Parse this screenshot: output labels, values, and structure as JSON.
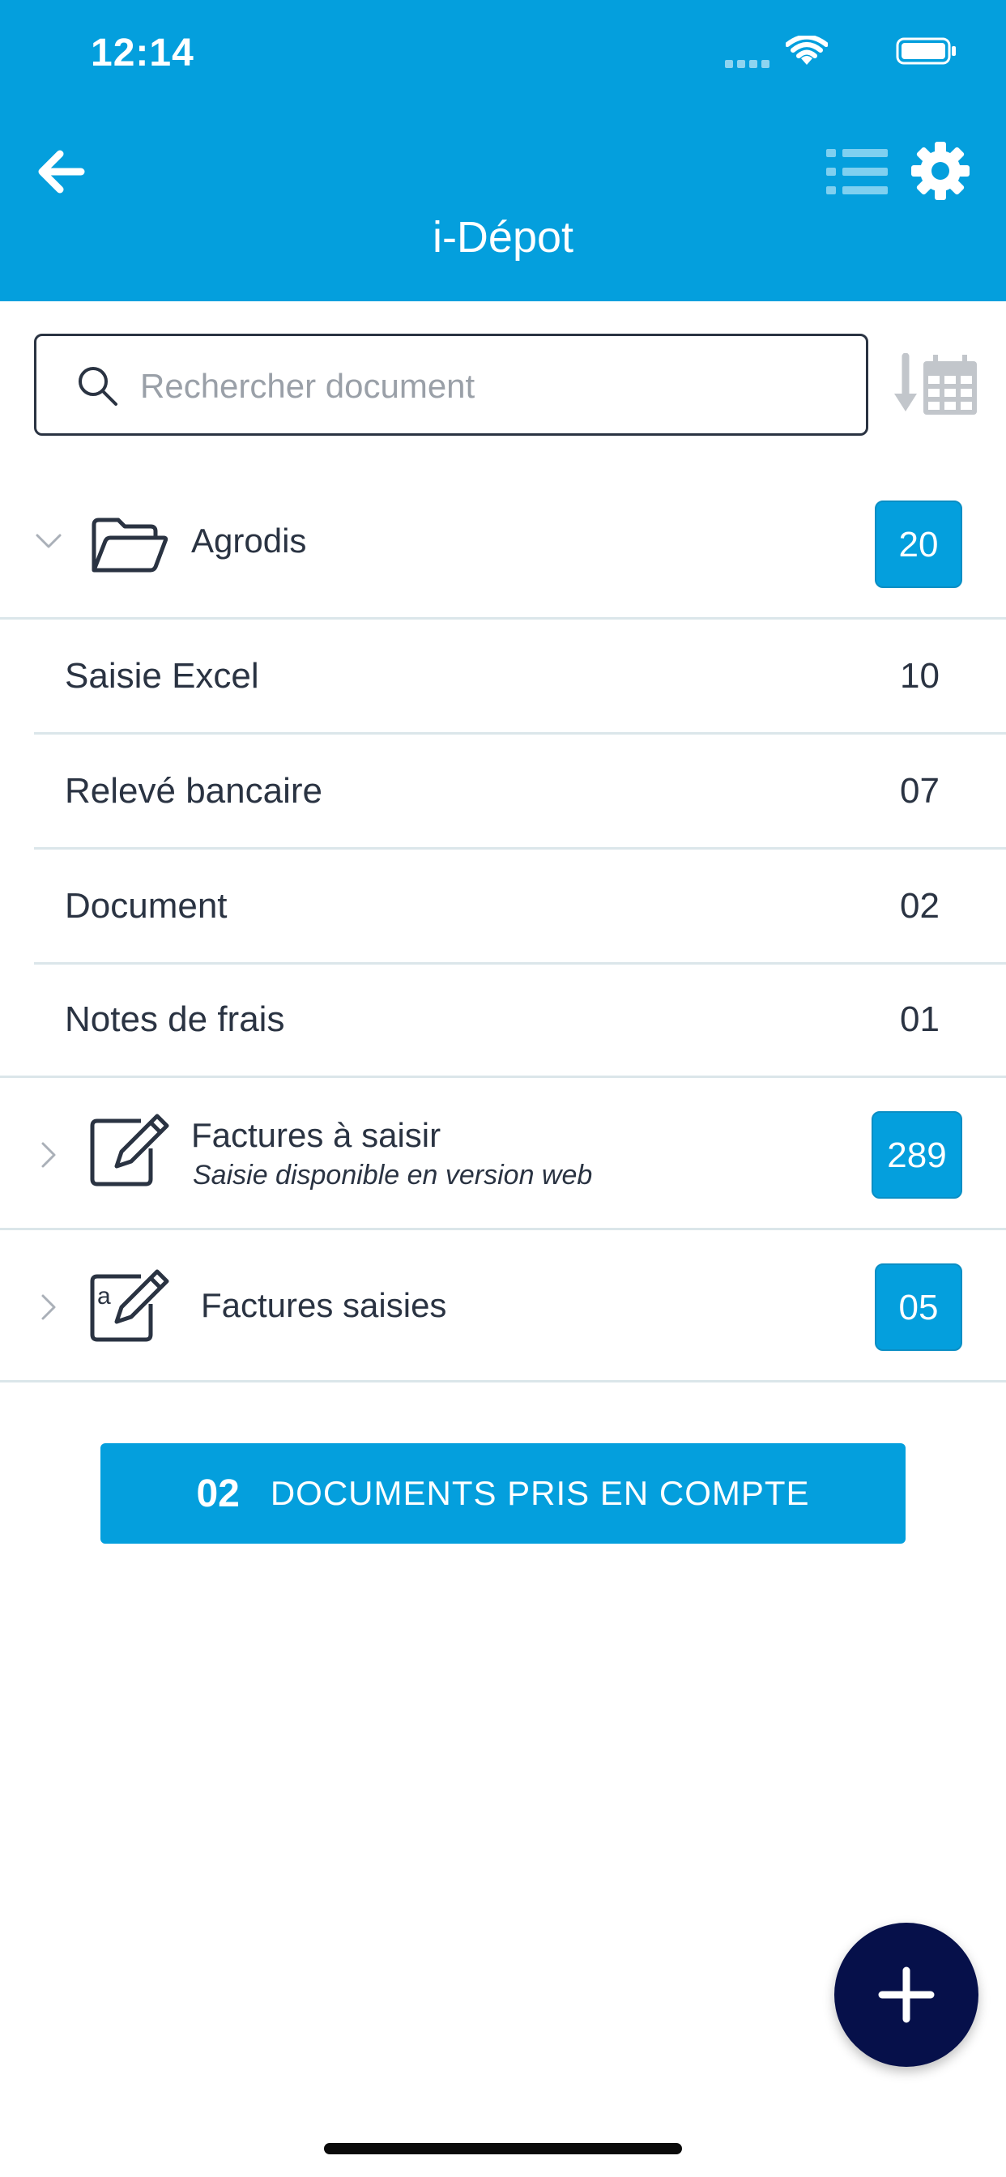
{
  "status_bar": {
    "time": "12:14"
  },
  "header": {
    "title": "i-Dépot"
  },
  "search": {
    "placeholder": "Rechercher document"
  },
  "folder": {
    "name": "Agrodis",
    "count": "20",
    "items": [
      {
        "label": "Saisie Excel",
        "count": "10"
      },
      {
        "label": "Relevé bancaire",
        "count": "07"
      },
      {
        "label": "Document",
        "count": "02"
      },
      {
        "label": "Notes de frais",
        "count": "01"
      }
    ]
  },
  "factures_a_saisir": {
    "label": "Factures à saisir",
    "subtitle": "Saisie disponible en version web",
    "count": "289"
  },
  "factures_saisies": {
    "label": "Factures saisies",
    "count": "05"
  },
  "cta": {
    "count": "02",
    "label": "DOCUMENTS PRIS EN COMPTE"
  },
  "colors": {
    "brand": "#049fdd",
    "fab": "#06104a",
    "text": "#2a3342",
    "divider": "#dbe6ea"
  },
  "icons": [
    "arrow-left-icon",
    "list-icon",
    "gear-icon",
    "search-icon",
    "sort-date-icon",
    "folder-open-icon",
    "edit-icon",
    "edit-a-icon",
    "plus-icon"
  ]
}
